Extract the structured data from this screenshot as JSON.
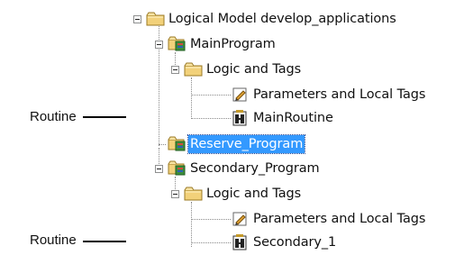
{
  "tree": {
    "root": {
      "label": "Logical Model develop_applications",
      "icon": "folder-icon"
    },
    "main_program": {
      "label": "MainProgram",
      "icon": "program-icon",
      "logic_folder": {
        "label": "Logic and Tags",
        "icon": "folder-icon"
      },
      "parameters": {
        "label": "Parameters and Local Tags",
        "icon": "tag-document-icon"
      },
      "routine": {
        "label": "MainRoutine",
        "icon": "routine-icon"
      }
    },
    "reserve_program": {
      "label": "Reserve_Program",
      "icon": "program-icon",
      "selected": true
    },
    "secondary_program": {
      "label": "Secondary_Program",
      "icon": "program-icon",
      "logic_folder": {
        "label": "Logic and Tags",
        "icon": "folder-icon"
      },
      "parameters": {
        "label": "Parameters and Local Tags",
        "icon": "tag-document-icon"
      },
      "routine": {
        "label": "Secondary_1",
        "icon": "routine-icon"
      }
    }
  },
  "callouts": [
    {
      "label": "Routine"
    },
    {
      "label": "Routine"
    }
  ],
  "colors": {
    "selection": "#3399ff",
    "folder": "#f2d17a",
    "arrow": "#000000"
  }
}
